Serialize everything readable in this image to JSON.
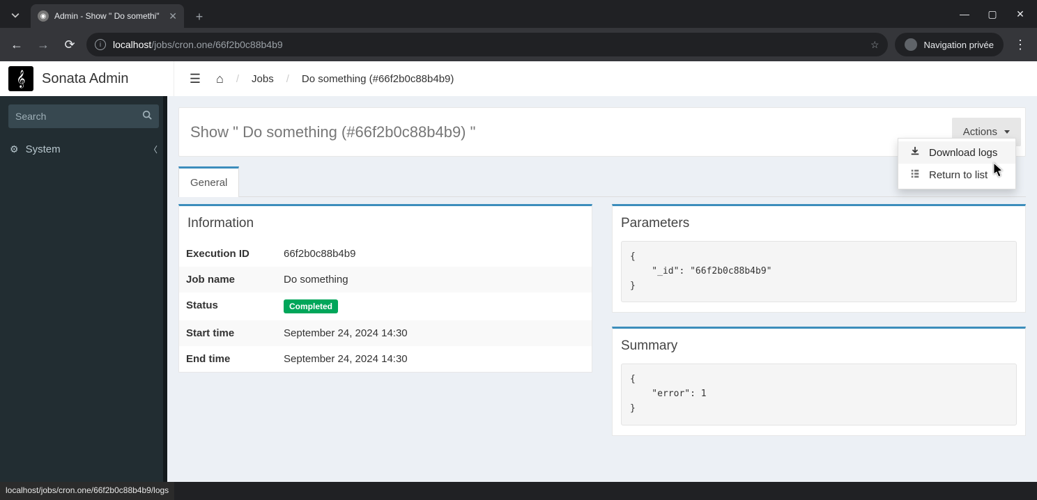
{
  "browser": {
    "tab_title": "Admin - Show \" Do somethi\"",
    "url_host": "localhost",
    "url_path": "/jobs/cron.one/66f2b0c88b4b9",
    "incognito_label": "Navigation privée",
    "status_url": "localhost/jobs/cron.one/66f2b0c88b4b9/logs"
  },
  "brand": "Sonata Admin",
  "search_placeholder": "Search",
  "sidebar": {
    "system_label": "System"
  },
  "breadcrumbs": {
    "jobs": "Jobs",
    "current": "Do something (#66f2b0c88b4b9)"
  },
  "page": {
    "title": "Show \" Do something (#66f2b0c88b4b9) \"",
    "actions_label": "Actions",
    "tab_general": "General"
  },
  "dropdown": {
    "download_logs": "Download logs",
    "return_to_list": "Return to list"
  },
  "info_panel": {
    "heading": "Information",
    "rows": {
      "exec_id_k": "Execution ID",
      "exec_id_v": "66f2b0c88b4b9",
      "job_name_k": "Job name",
      "job_name_v": "Do something",
      "status_k": "Status",
      "status_v": "Completed",
      "start_k": "Start time",
      "start_v": "September 24, 2024 14:30",
      "end_k": "End time",
      "end_v": "September 24, 2024 14:30"
    }
  },
  "params_panel": {
    "heading": "Parameters",
    "code": "{\n    \"_id\": \"66f2b0c88b4b9\"\n}"
  },
  "summary_panel": {
    "heading": "Summary",
    "code": "{\n    \"error\": 1\n}"
  }
}
